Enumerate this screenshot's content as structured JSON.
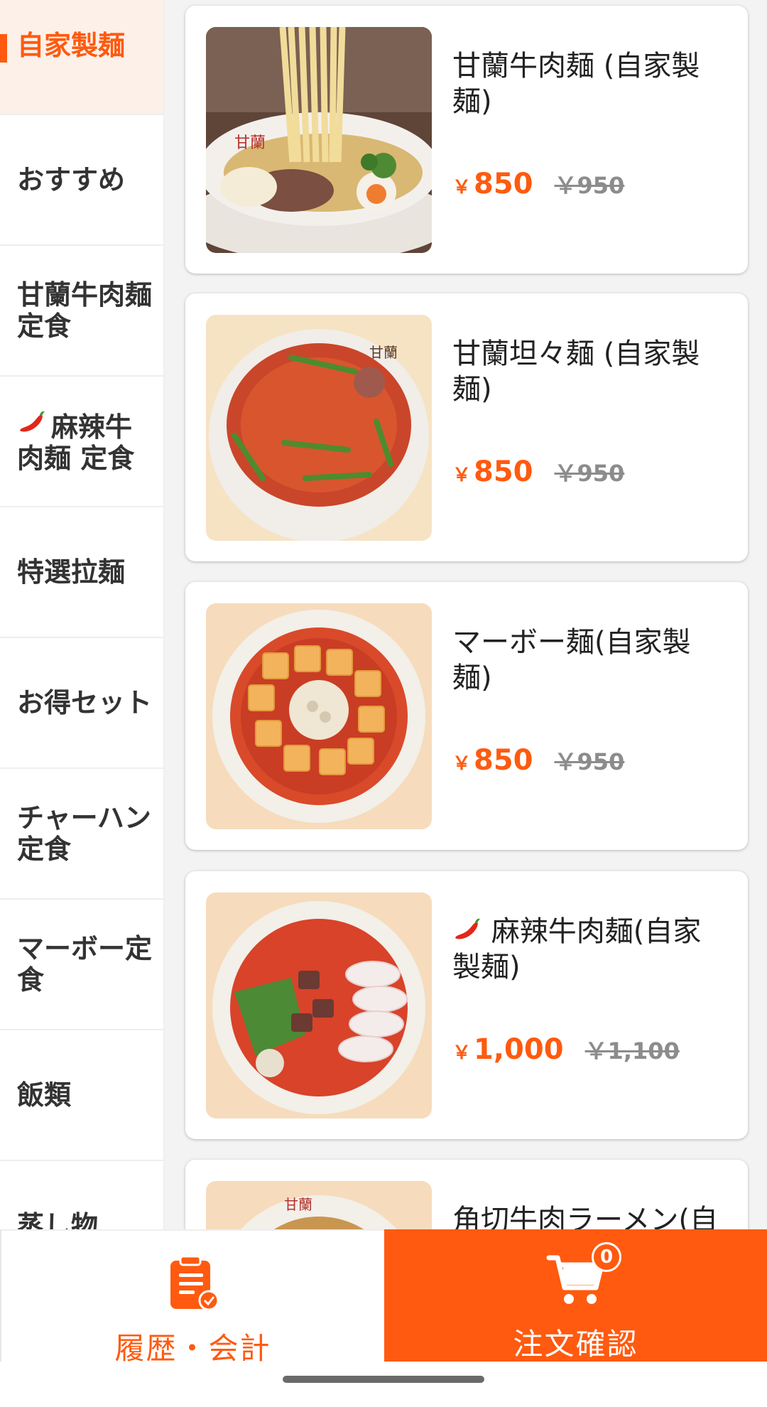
{
  "sidebar": {
    "categories": [
      {
        "label": "自家製麺",
        "active": true
      },
      {
        "label": "おすすめ"
      },
      {
        "label": "甘蘭牛肉麺定食"
      },
      {
        "label": "麻辣牛肉麺 定食",
        "icon": "chili-pepper-icon"
      },
      {
        "label": "特選拉麺"
      },
      {
        "label": "お得セット"
      },
      {
        "label": "チャーハン定食"
      },
      {
        "label": "マーボー定食"
      },
      {
        "label": "飯類"
      },
      {
        "label": "蒸し物"
      }
    ]
  },
  "menu": {
    "currency_symbol": "￥",
    "items": [
      {
        "name": "甘蘭牛肉麺 (自家製麺)",
        "price": "850",
        "old_price": "￥950"
      },
      {
        "name": "甘蘭坦々麺 (自家製麺)",
        "price": "850",
        "old_price": "￥950"
      },
      {
        "name": "マーボー麺(自家製麺)",
        "price": "850",
        "old_price": "￥950"
      },
      {
        "name": "麻辣牛肉麺(自家製麺)",
        "icon": "chili-pepper-icon",
        "price": "1,000",
        "old_price": "￥1,100"
      },
      {
        "name": "角切牛肉ラーメン(自"
      }
    ]
  },
  "bottom_bar": {
    "history_label": "履歴・会計",
    "order_label": "注文確認",
    "cart_count": "0"
  },
  "colors": {
    "accent": "#ff5a0f",
    "active_bg": "#fdf0e8"
  }
}
